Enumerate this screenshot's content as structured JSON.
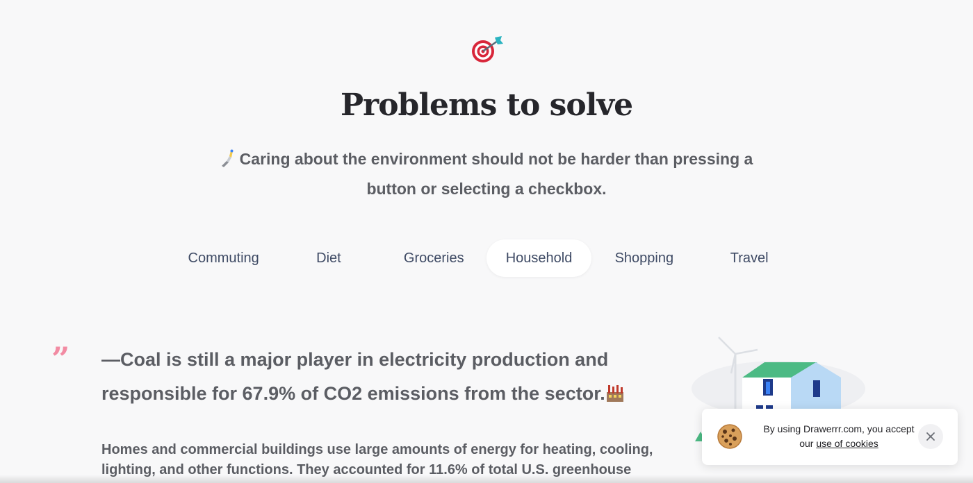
{
  "header": {
    "icon": "target-dart-icon",
    "title": "Problems to solve",
    "subtitle_icon": "hand-pointing-icon",
    "subtitle": "Caring about the environment should not be harder than pressing a button or selecting a checkbox."
  },
  "tabs": [
    {
      "label": "Commuting"
    },
    {
      "label": "Diet"
    },
    {
      "label": "Groceries"
    },
    {
      "label": "Household",
      "active": true
    },
    {
      "label": "Shopping"
    },
    {
      "label": "Travel"
    }
  ],
  "content": {
    "quote_icon": "quote-mark-icon",
    "quote": "—Coal is still a major player in electricity production and responsible for 67.9% of CO2 emissions from the sector.",
    "quote_suffix_icon": "factory-icon",
    "body": "Homes and commercial buildings use large amounts of energy for heating, cooling, lighting, and other functions. They accounted for 11.6% of total U.S. greenhouse",
    "illustration": "house-with-wind-turbine-illustration"
  },
  "cookie_banner": {
    "icon": "cookie-icon",
    "text_before": "By using Drawerrr.com, you accept our ",
    "link_text": "use of cookies",
    "close_icon": "close-icon"
  },
  "colors": {
    "background": "#f8f8f9",
    "title": "#26262b",
    "text": "#5b5d63",
    "tab_text": "#3e4a64",
    "quote_mark": "#f28ba3",
    "house_roof": "#4cba84",
    "house_wall": "#b9d9f5"
  }
}
